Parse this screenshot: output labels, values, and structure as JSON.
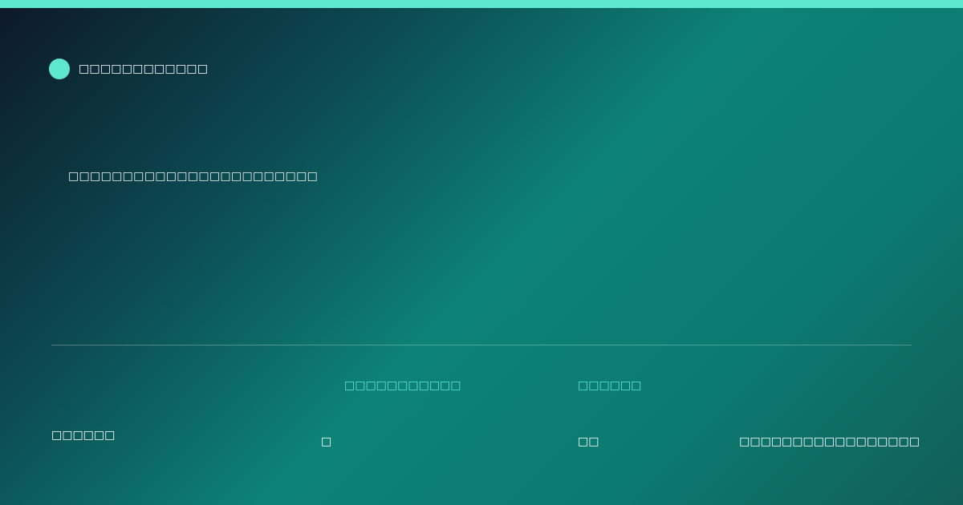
{
  "colors": {
    "accent": "#5ee8d2",
    "background_start": "#0d1828",
    "background_mid": "#0d8276",
    "background_end": "#125e58"
  },
  "brand": {
    "name": "□□□□□□□□□□□□"
  },
  "headline": {
    "text": "□□□□□□□□□□□□□□□□□□□□□□□"
  },
  "stats": {
    "left_value": "□□□□□□",
    "col_a_label": "□□□□□□□□□□□",
    "col_a_value": "□",
    "col_b_label": "□□□□□□",
    "col_b_value": "□□",
    "right_value": "□□□□□□□□□□□□□□□□□"
  }
}
